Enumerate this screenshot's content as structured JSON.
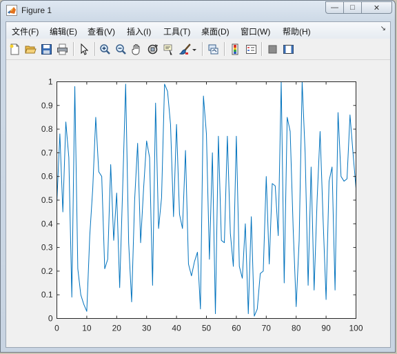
{
  "window": {
    "title": "Figure 1",
    "controls": {
      "minimize": "—",
      "maximize": "□",
      "close": "✕"
    }
  },
  "menu": {
    "items": [
      "文件(F)",
      "编辑(E)",
      "查看(V)",
      "插入(I)",
      "工具(T)",
      "桌面(D)",
      "窗口(W)",
      "帮助(H)"
    ],
    "overflow_icon": "double-chevron-icon"
  },
  "toolbar": {
    "buttons": [
      "new-figure-icon",
      "open-file-icon",
      "save-icon",
      "print-icon",
      "pointer-icon",
      "zoom-in-icon",
      "zoom-out-icon",
      "pan-icon",
      "rotate-3d-icon",
      "data-cursor-icon",
      "brush-icon",
      "link-plot-icon",
      "colorbar-icon",
      "legend-icon",
      "hide-plot-tools-icon",
      "show-plot-tools-icon"
    ]
  },
  "chart_data": {
    "type": "line",
    "title": "",
    "xlabel": "",
    "ylabel": "",
    "xlim": [
      0,
      100
    ],
    "ylim": [
      0,
      1
    ],
    "xticks": [
      "0",
      "10",
      "20",
      "30",
      "40",
      "50",
      "60",
      "70",
      "80",
      "90",
      "100"
    ],
    "yticks": [
      "0",
      "0.1",
      "0.2",
      "0.3",
      "0.4",
      "0.5",
      "0.6",
      "0.7",
      "0.8",
      "0.9",
      "1"
    ],
    "grid": false,
    "color": "#0072bd",
    "series": [
      {
        "x": [
          0,
          1,
          2,
          3,
          4,
          5,
          6,
          7,
          8,
          9,
          10,
          11,
          12,
          13,
          14,
          15,
          16,
          17,
          18,
          19,
          20,
          21,
          22,
          23,
          24,
          25,
          26,
          27,
          28,
          29,
          30,
          31,
          32,
          33,
          34,
          35,
          36,
          37,
          38,
          39,
          40,
          41,
          42,
          43,
          44,
          45,
          46,
          47,
          48,
          49,
          50,
          51,
          52,
          53,
          54,
          55,
          56,
          57,
          58,
          59,
          60,
          61,
          62,
          63,
          64,
          65,
          66,
          67,
          68,
          69,
          70,
          71,
          72,
          73,
          74,
          75,
          76,
          77,
          78,
          79,
          80,
          81,
          82,
          83,
          84,
          85,
          86,
          87,
          88,
          89,
          90,
          91,
          92,
          93,
          94,
          95,
          96,
          97,
          98,
          99,
          100
        ],
        "y": [
          0.49,
          0.78,
          0.45,
          0.83,
          0.68,
          0.09,
          0.98,
          0.21,
          0.1,
          0.06,
          0.03,
          0.35,
          0.55,
          0.85,
          0.62,
          0.6,
          0.21,
          0.25,
          0.65,
          0.33,
          0.53,
          0.13,
          0.55,
          0.99,
          0.32,
          0.07,
          0.5,
          0.74,
          0.32,
          0.55,
          0.75,
          0.68,
          0.14,
          0.91,
          0.38,
          0.51,
          0.99,
          0.96,
          0.82,
          0.43,
          0.82,
          0.44,
          0.38,
          0.71,
          0.23,
          0.18,
          0.24,
          0.28,
          0.04,
          0.94,
          0.78,
          0.25,
          0.7,
          0.02,
          0.77,
          0.33,
          0.32,
          0.77,
          0.36,
          0.22,
          0.77,
          0.22,
          0.17,
          0.4,
          0.02,
          0.43,
          0.01,
          0.04,
          0.19,
          0.2,
          0.6,
          0.23,
          0.57,
          0.56,
          0.35,
          1.0,
          0.15,
          0.85,
          0.79,
          0.38,
          0.05,
          0.33,
          1.0,
          0.7,
          0.14,
          0.64,
          0.12,
          0.5,
          0.79,
          0.42,
          0.08,
          0.58,
          0.64,
          0.12,
          0.87,
          0.6,
          0.58,
          0.59,
          0.86,
          0.7,
          0.55
        ]
      }
    ]
  }
}
